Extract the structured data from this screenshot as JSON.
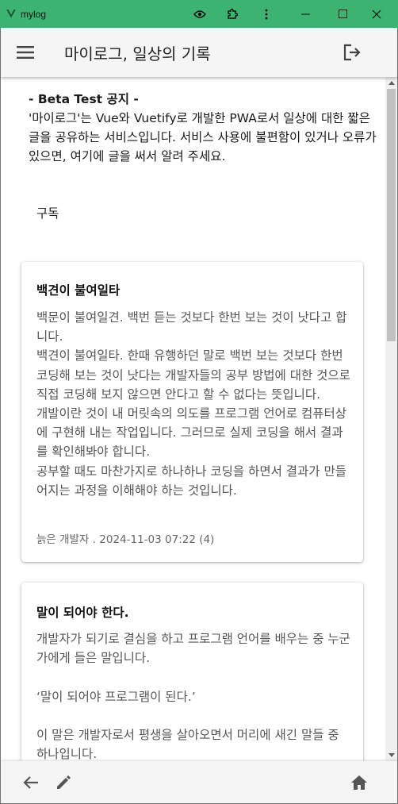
{
  "window": {
    "title": "mylog",
    "buttons": [
      "eye-icon",
      "puzzle-icon",
      "more-vert-icon",
      "minimize-icon",
      "maximize-icon",
      "close-icon"
    ],
    "accent": "#3cb371"
  },
  "appbar": {
    "title": "마이로그, 일상의 기록",
    "menu_icon": "menu-icon",
    "logout_icon": "logout-icon"
  },
  "notice": {
    "title": "- Beta Test 공지 -",
    "body": "'마이로그'는 Vue와 Vuetify로 개발한 PWA로서 일상에 대한 짧은 글을 공유하는 서비스입니다. 서비스 사용에 불편함이 있거나 오류가 있으면, 여기에 글을 써서 알려 주세요."
  },
  "subscribe_label": "구독",
  "posts": [
    {
      "title": "백견이 불여일타",
      "paragraphs": [
        "백문이 불여일견. 백번 듣는 것보다 한번 보는 것이 낫다고 합니다.",
        "백견이 불여일타. 한때 유행하던 말로 백번 보는 것보다 한번 코딩해 보는 것이 낫다는 개발자들의 공부 방법에 대한 것으로 직접 코딩해 보지 않으면 안다고 할 수 없다는 뜻입니다.",
        "개발이란 것이 내 머릿속의 의도를 프로그램 언어로 컴퓨터상에 구현해 내는 작업입니다. 그러므로 실제 코딩을 해서 결과를 확인해봐야 합니다.",
        "공부할 때도 마찬가지로 하나하나 코딩을 하면서 결과가 만들어지는 과정을 이해해야 하는 것입니다."
      ],
      "meta": "늙은 개발자 . 2024-11-03 07:22 (4)"
    },
    {
      "title": "말이 되어야 한다.",
      "paragraphs": [
        "개발자가 되기로 결심을 하고 프로그램 언어를 배우는 중 누군가에게 들은 말입니다.",
        "",
        "‘말이 되어야 프로그램이 된다.’",
        "",
        "이 말은 개발자로서 평생을 살아오면서 머리에 새긴 말들 중 하나입니다."
      ]
    }
  ],
  "bottom_nav": [
    "back-arrow-icon",
    "pencil-icon",
    "home-icon"
  ]
}
